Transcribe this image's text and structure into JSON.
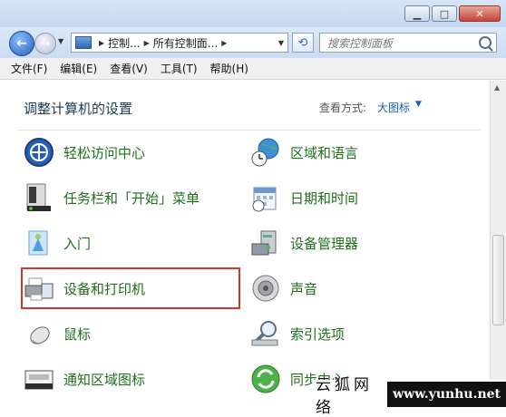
{
  "window": {
    "buttons": {
      "minimize": "▁",
      "maximize": "□",
      "close": "✕"
    }
  },
  "nav": {
    "back_label": "←",
    "forward_label": "→",
    "breadcrumb": [
      "控制...",
      "所有控制面..."
    ],
    "search_placeholder": "搜索控制面板"
  },
  "menu": [
    "文件(F)",
    "编辑(E)",
    "查看(V)",
    "工具(T)",
    "帮助(H)"
  ],
  "header": {
    "title": "调整计算机的设置",
    "viewby_label": "查看方式:",
    "viewby_value": "大图标"
  },
  "items_left": [
    {
      "label": "轻松访问中心",
      "icon": "ease-of-access-icon"
    },
    {
      "label": "任务栏和「开始」菜单",
      "icon": "taskbar-icon"
    },
    {
      "label": "入门",
      "icon": "getting-started-icon"
    },
    {
      "label": "设备和打印机",
      "icon": "printer-icon"
    },
    {
      "label": "鼠标",
      "icon": "mouse-icon"
    },
    {
      "label": "通知区域图标",
      "icon": "notification-icon"
    }
  ],
  "items_right": [
    {
      "label": "区域和语言",
      "icon": "globe-clock-icon"
    },
    {
      "label": "日期和时间",
      "icon": "calendar-icon"
    },
    {
      "label": "设备管理器",
      "icon": "device-manager-icon"
    },
    {
      "label": "声音",
      "icon": "speaker-icon"
    },
    {
      "label": "索引选项",
      "icon": "index-search-icon"
    },
    {
      "label": "同步中心",
      "icon": "sync-icon"
    }
  ],
  "watermark": {
    "cn": "云狐网络",
    "url": "www.yunhu.net"
  },
  "colors": {
    "link_green": "#1f6f1b",
    "highlight_red": "#d9342b",
    "title_blue": "#1e395b"
  }
}
